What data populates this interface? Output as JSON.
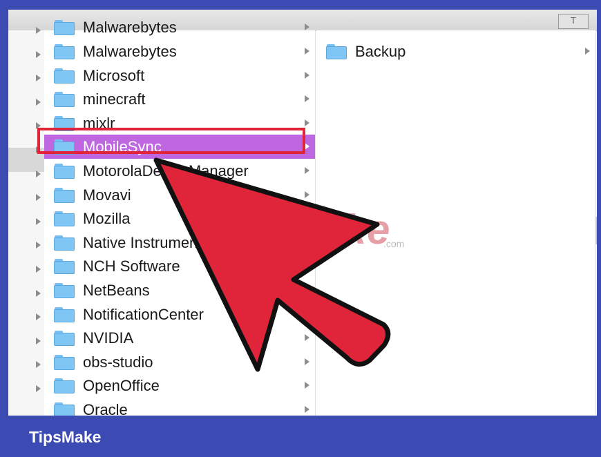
{
  "top_control": "T",
  "column1": {
    "partial_top": "Malwarebytes",
    "items": [
      {
        "label": "Malwarebytes"
      },
      {
        "label": "Microsoft"
      },
      {
        "label": "minecraft"
      },
      {
        "label": "mixlr"
      },
      {
        "label": "MobileSync",
        "selected": true
      },
      {
        "label": "MotorolaDeviceManager"
      },
      {
        "label": "Movavi"
      },
      {
        "label": "Mozilla"
      },
      {
        "label": "Native Instruments"
      },
      {
        "label": "NCH Software"
      },
      {
        "label": "NetBeans"
      },
      {
        "label": "NotificationCenter"
      },
      {
        "label": "NVIDIA"
      },
      {
        "label": "obs-studio"
      },
      {
        "label": "OpenOffice"
      },
      {
        "label": "Oracle"
      }
    ]
  },
  "column2": {
    "items": [
      {
        "label": "Backup"
      }
    ]
  },
  "watermark": {
    "text": "TipsMake",
    "suffix": ".com"
  },
  "footer": {
    "brand": "TipsMake"
  },
  "colors": {
    "frame_border": "#3c4ab4",
    "selection": "#bf67e0",
    "highlight_box": "#e0253a",
    "arrow_fill": "#e0253a",
    "folder": "#7fc6f4"
  },
  "icons": [
    "folder-icon",
    "disclosure-triangle-icon",
    "chevron-right-icon",
    "pointer-arrow-icon"
  ]
}
